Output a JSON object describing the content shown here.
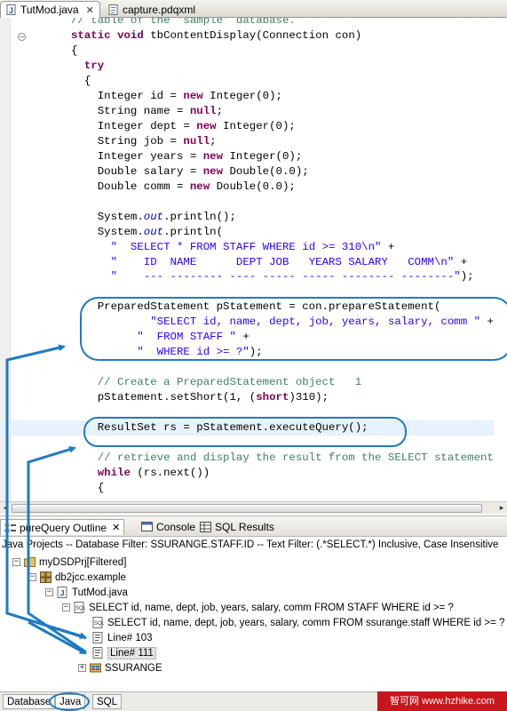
{
  "editor_tabs": [
    {
      "label": "TutMod.java",
      "active": true,
      "icon": "java-file-icon"
    },
    {
      "label": "capture.pdqxml",
      "active": false,
      "icon": "xml-file-icon"
    }
  ],
  "code_lines": [
    [
      {
        "t": "// table of the 'sample' database.",
        "c": "cmt"
      }
    ],
    [
      {
        "t": "static",
        "c": "kw"
      },
      {
        "t": " "
      },
      {
        "t": "void",
        "c": "kw"
      },
      {
        "t": " tbContentDisplay(Connection con)"
      }
    ],
    [
      {
        "t": "{"
      }
    ],
    [
      {
        "t": "  "
      },
      {
        "t": "try",
        "c": "kw"
      }
    ],
    [
      {
        "t": "  {"
      }
    ],
    [
      {
        "t": "    Integer id = "
      },
      {
        "t": "new",
        "c": "kw"
      },
      {
        "t": " Integer(0);"
      }
    ],
    [
      {
        "t": "    String name = "
      },
      {
        "t": "null",
        "c": "kw"
      },
      {
        "t": ";"
      }
    ],
    [
      {
        "t": "    Integer dept = "
      },
      {
        "t": "new",
        "c": "kw"
      },
      {
        "t": " Integer(0);"
      }
    ],
    [
      {
        "t": "    String job = "
      },
      {
        "t": "null",
        "c": "kw"
      },
      {
        "t": ";"
      }
    ],
    [
      {
        "t": "    Integer years = "
      },
      {
        "t": "new",
        "c": "kw"
      },
      {
        "t": " Integer(0);"
      }
    ],
    [
      {
        "t": "    Double salary = "
      },
      {
        "t": "new",
        "c": "kw"
      },
      {
        "t": " Double(0.0);"
      }
    ],
    [
      {
        "t": "    Double comm = "
      },
      {
        "t": "new",
        "c": "kw"
      },
      {
        "t": " Double(0.0);"
      }
    ],
    [
      {
        "t": ""
      }
    ],
    [
      {
        "t": "    System."
      },
      {
        "t": "out",
        "c": "fld"
      },
      {
        "t": ".println();"
      }
    ],
    [
      {
        "t": "    System."
      },
      {
        "t": "out",
        "c": "fld"
      },
      {
        "t": ".println("
      }
    ],
    [
      {
        "t": "      "
      },
      {
        "t": "\"  SELECT * FROM STAFF WHERE id >= 310\\n\"",
        "c": "str"
      },
      {
        "t": " +"
      }
    ],
    [
      {
        "t": "      "
      },
      {
        "t": "\"    ID  NAME      DEPT JOB   YEARS SALARY   COMM\\n\"",
        "c": "str"
      },
      {
        "t": " +"
      }
    ],
    [
      {
        "t": "      "
      },
      {
        "t": "\"    --- -------- ---- ----- ----- -------- --------\"",
        "c": "str"
      },
      {
        "t": ");"
      }
    ],
    [
      {
        "t": ""
      }
    ],
    [
      {
        "t": "    PreparedStatement pStatement = con.prepareStatement("
      }
    ],
    [
      {
        "t": "            "
      },
      {
        "t": "\"SELECT id, name, dept, job, years, salary, comm \"",
        "c": "str"
      },
      {
        "t": " +"
      }
    ],
    [
      {
        "t": "          "
      },
      {
        "t": "\"  FROM STAFF \"",
        "c": "str"
      },
      {
        "t": " +"
      }
    ],
    [
      {
        "t": "          "
      },
      {
        "t": "\"  WHERE id >= ?\"",
        "c": "str"
      },
      {
        "t": ");"
      }
    ],
    [
      {
        "t": ""
      }
    ],
    [
      {
        "t": "    "
      },
      {
        "t": "// Create a PreparedStatement object   1",
        "c": "cmt"
      }
    ],
    [
      {
        "t": "    pStatement.setShort(1, ("
      },
      {
        "t": "short",
        "c": "kw"
      },
      {
        "t": ")310);"
      }
    ],
    [
      {
        "t": ""
      }
    ],
    [
      {
        "t": "    ResultSet rs = pStatement.executeQuery();"
      }
    ],
    [
      {
        "t": ""
      }
    ],
    [
      {
        "t": "    "
      },
      {
        "t": "// retrieve and display the result from the SELECT statement",
        "c": "cmt"
      }
    ],
    [
      {
        "t": "    "
      },
      {
        "t": "while",
        "c": "kw"
      },
      {
        "t": " (rs.next())"
      }
    ],
    [
      {
        "t": "    {"
      }
    ]
  ],
  "current_line_index": 27,
  "view_tabs": [
    {
      "label": "pureQuery Outline",
      "active": true,
      "icon": "outline-icon"
    },
    {
      "label": "Console",
      "active": false,
      "icon": "console-icon"
    },
    {
      "label": "SQL Results",
      "active": false,
      "icon": "sql-results-icon"
    }
  ],
  "filter_text": "Java Projects -- Database Filter: SSURANGE.STAFF.ID  -- Text Filter: (.*SELECT.*) Inclusive, Case Insensitive",
  "tree": [
    {
      "label": "myDSDPrj[Filtered]",
      "icon": "project-icon",
      "toggle": "−"
    },
    {
      "label": "db2jcc.example",
      "icon": "package-icon",
      "toggle": "−"
    },
    {
      "label": "TutMod.java",
      "icon": "java-file-icon",
      "toggle": "−"
    },
    {
      "label": "SELECT id, name, dept, job, years, salary, comm   FROM STAFF   WHERE id >= ?",
      "icon": "sql-statement-icon",
      "toggle": "−"
    },
    {
      "label": "SELECT id, name, dept, job, years, salary, comm   FROM ssurange.staff   WHERE id >= ? fetch",
      "icon": "sql-statement-icon",
      "toggle": ""
    },
    {
      "label": "Line# 103",
      "icon": "source-line-icon",
      "toggle": ""
    },
    {
      "label": "Line# 111",
      "icon": "source-line-icon",
      "toggle": "",
      "selected": true
    },
    {
      "label": "SSURANGE",
      "icon": "schema-icon",
      "toggle": "+"
    }
  ],
  "bottom_tabs": [
    {
      "label": "Database",
      "active": false
    },
    {
      "label": "Java",
      "active": true
    },
    {
      "label": "SQL",
      "active": false
    }
  ],
  "watermark": "智可网 www.hzhike.com",
  "colors": {
    "annotation": "#1f7bc0",
    "keyword": "#7f0055",
    "string": "#2a00ff",
    "comment": "#3f7f5f",
    "field": "#0000c0",
    "current_line": "#e8f2fe"
  }
}
